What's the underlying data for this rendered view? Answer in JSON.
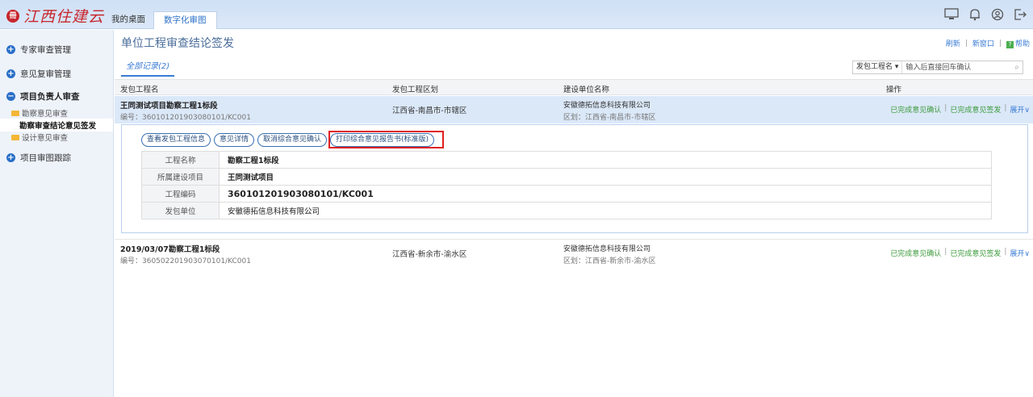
{
  "app": {
    "logo_mark": "冊",
    "logo_text": "江西住建云"
  },
  "top_tabs": [
    {
      "label": "我的桌面"
    },
    {
      "label": "数字化审图"
    }
  ],
  "sidebar": {
    "groups": [
      {
        "label": "专家审查管理",
        "icon": "plus"
      },
      {
        "label": "意见复审管理",
        "icon": "plus"
      },
      {
        "label": "项目负责人审查",
        "icon": "minus",
        "items": [
          {
            "label": "勘察意见审查"
          },
          {
            "label": "勘察审查结论意见签发"
          },
          {
            "label": "设计意见审查"
          }
        ]
      },
      {
        "label": "项目审图跟踪",
        "icon": "plus"
      }
    ]
  },
  "main": {
    "title": "单位工程审查结论签发",
    "links": {
      "refresh": "刷新",
      "new_window": "新窗口",
      "help": "帮助",
      "help_icon": "?"
    },
    "subtab": "全部记录(2)",
    "search": {
      "field": "发包工程名 ▾",
      "placeholder": "输入后直接回车确认"
    },
    "columns": [
      "发包工程名",
      "发包工程区划",
      "建设单位名称",
      "操作"
    ],
    "rows": [
      {
        "name": "王同测试项目勘察工程1标段",
        "code": "编号：360101201903080101/KC001",
        "region": "江西省-南昌市-市辖区",
        "unit": "安徽德拓信息科技有限公司",
        "area": "区划：江西省-南昌市-市辖区",
        "op1": "已完成意见确认",
        "op2": "已完成意见签发",
        "op3": "展开∨"
      },
      {
        "name": "2019/03/07勘察工程1标段",
        "code": "编号：360502201903070101/KC001",
        "region": "江西省-新余市-渝水区",
        "unit": "安徽德拓信息科技有限公司",
        "area": "区划：江西省-新余市-渝水区",
        "op1": "已完成意见确认",
        "op2": "已完成意见签发",
        "op3": "展开∨"
      }
    ],
    "detail": {
      "buttons": [
        "查看发包工程信息",
        "意见详情",
        "取消综合意见确认",
        "打印综合意见报告书(标准版)"
      ],
      "fields": [
        {
          "k": "工程名称",
          "v": "勘察工程1标段"
        },
        {
          "k": "所属建设项目",
          "v": "王同测试项目"
        },
        {
          "k": "工程编码",
          "v": "360101201903080101/KC001"
        },
        {
          "k": "发包单位",
          "v": "安徽德拓信息科技有限公司"
        }
      ]
    }
  }
}
